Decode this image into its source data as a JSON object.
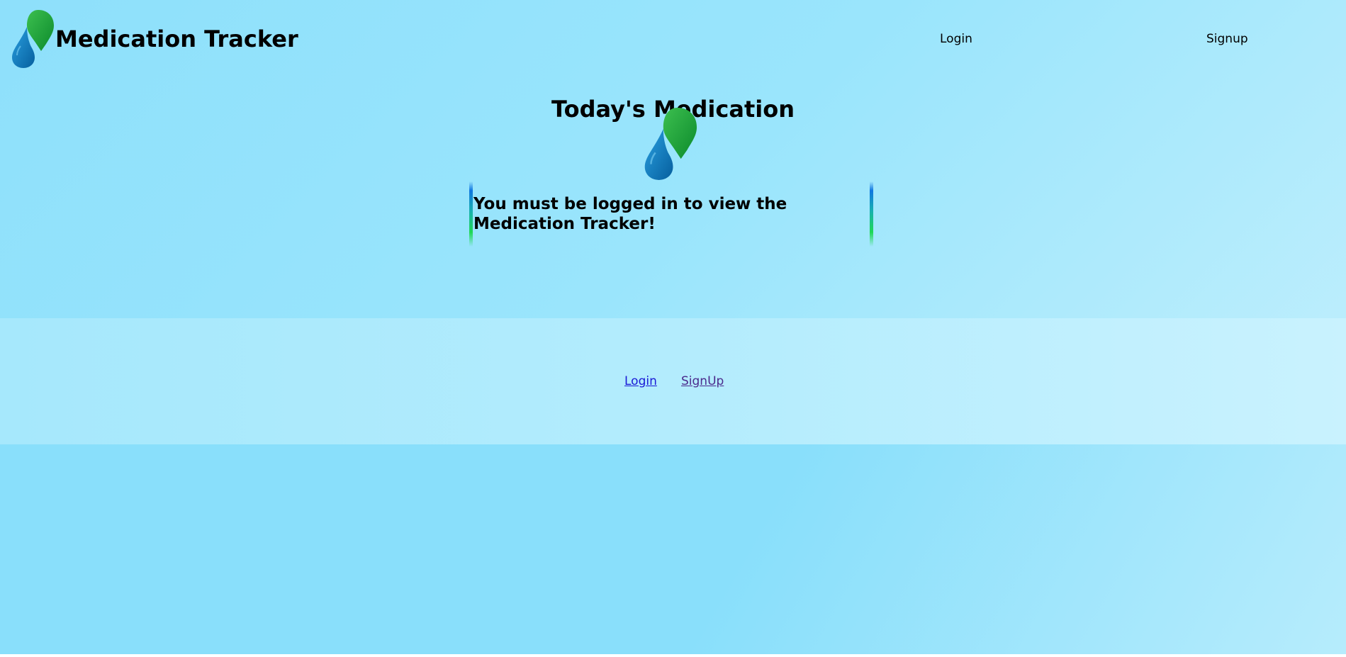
{
  "header": {
    "brand_title": "Medication Tracker",
    "logo_icon": "water-drop-and-leaf-icon",
    "nav": {
      "login_label": "Login",
      "signup_label": "Signup"
    }
  },
  "main": {
    "title": "Today's Medication",
    "logo_icon": "water-drop-and-leaf-icon",
    "notice_text": "You must be logged in to view the Medication Tracker!"
  },
  "footer": {
    "login_label": "Login",
    "signup_label": "SignUp"
  },
  "colors": {
    "background_light_blue": "#9ae5fc",
    "drop_blue": "#0b7bc4",
    "leaf_green": "#15a238",
    "accent_bar_blue": "#1077e0",
    "accent_bar_green": "#1fd855",
    "footer_link_login": "#1a1ad6",
    "footer_link_signup_visited": "#4b2a8c"
  }
}
